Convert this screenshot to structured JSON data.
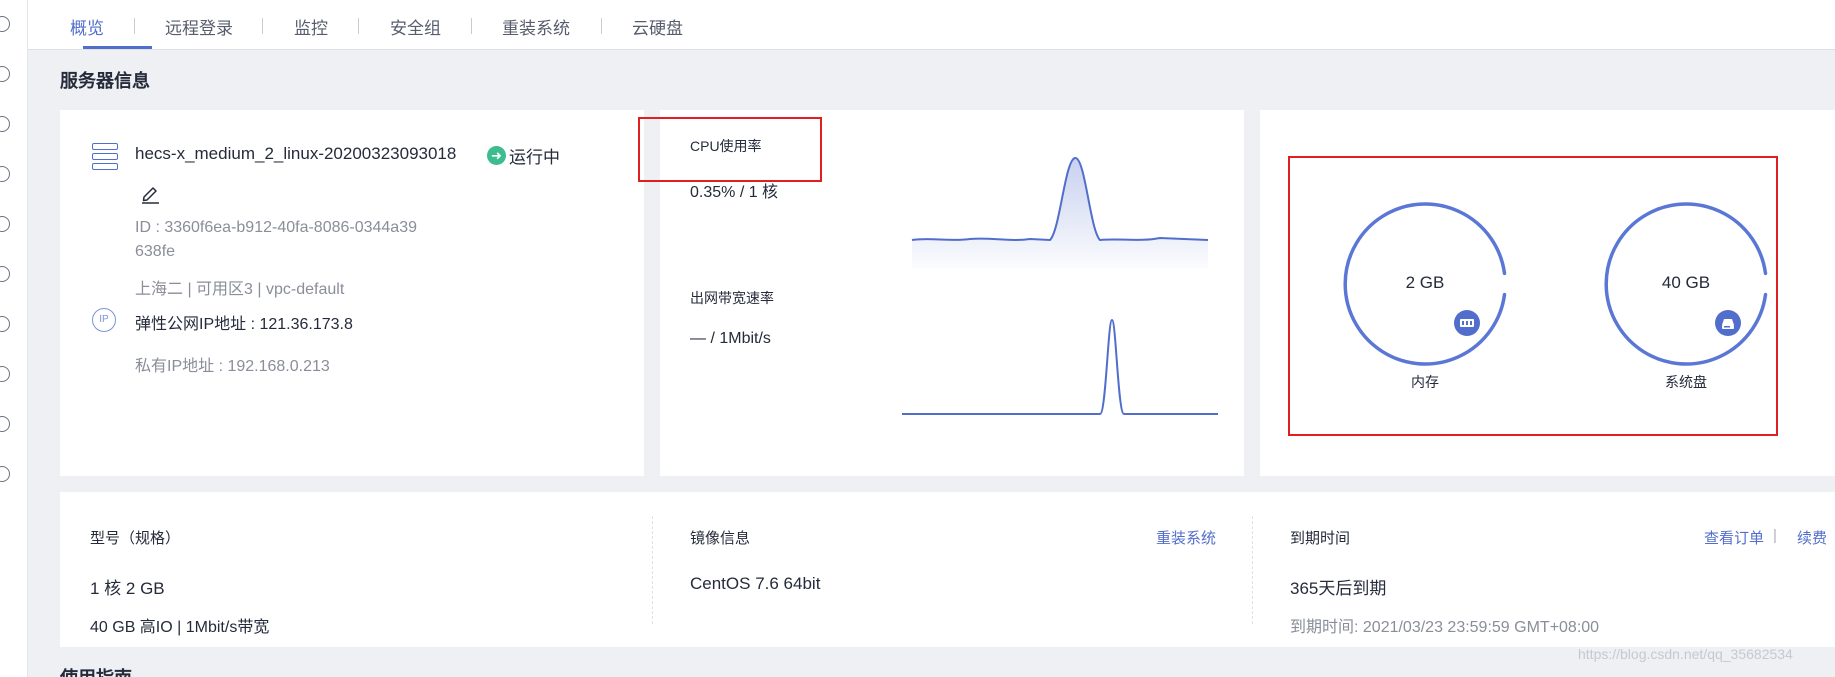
{
  "tabs": [
    {
      "label": "概览",
      "active": true
    },
    {
      "label": "远程登录"
    },
    {
      "label": "监控"
    },
    {
      "label": "安全组"
    },
    {
      "label": "重装系统"
    },
    {
      "label": "云硬盘"
    }
  ],
  "section": {
    "title": "服务器信息"
  },
  "server": {
    "name": "hecs-x_medium_2_linux-20200323093018",
    "status": "运行中",
    "id": "ID : 3360f6ea-b912-40fa-8086-0344a39638fe",
    "region": "上海二 | 可用区3 | vpc-default",
    "eip": "弹性公网IP地址 : 121.36.173.8",
    "private_ip": "私有IP地址 : 192.168.0.213",
    "ip_icon_text": "IP"
  },
  "metrics": {
    "cpu_label": "CPU使用率",
    "cpu_value": "0.35% / 1 核",
    "bw_label": "出网带宽速率",
    "bw_value": "— / 1Mbit/s"
  },
  "resources": {
    "memory_value": "2 GB",
    "memory_label": "内存",
    "disk_value": "40 GB",
    "disk_label": "系统盘"
  },
  "specs": {
    "type_title": "型号（规格）",
    "type_value": "1 核 2 GB",
    "type_detail": "40 GB 高IO | 1Mbit/s带宽",
    "image_title": "镜像信息",
    "image_link": "重装系统",
    "image_value": "CentOS 7.6 64bit",
    "expire_title": "到期时间",
    "order_link": "查看订单",
    "link_sep": "|",
    "renew_link": "续费",
    "expire_value": "365天后到期",
    "expire_time": "到期时间: 2021/03/23 23:59:59 GMT+08:00"
  },
  "footer": {
    "title": "使用指南"
  },
  "watermark": "https://blog.csdn.net/qq_35682534",
  "colors": {
    "accent": "#526ecc",
    "running": "#3cbc8f",
    "highlight": "#e02020"
  },
  "icons": [
    "server-icon",
    "edit-icon",
    "ip-icon",
    "memory-icon",
    "disk-icon",
    "running-status-icon"
  ]
}
